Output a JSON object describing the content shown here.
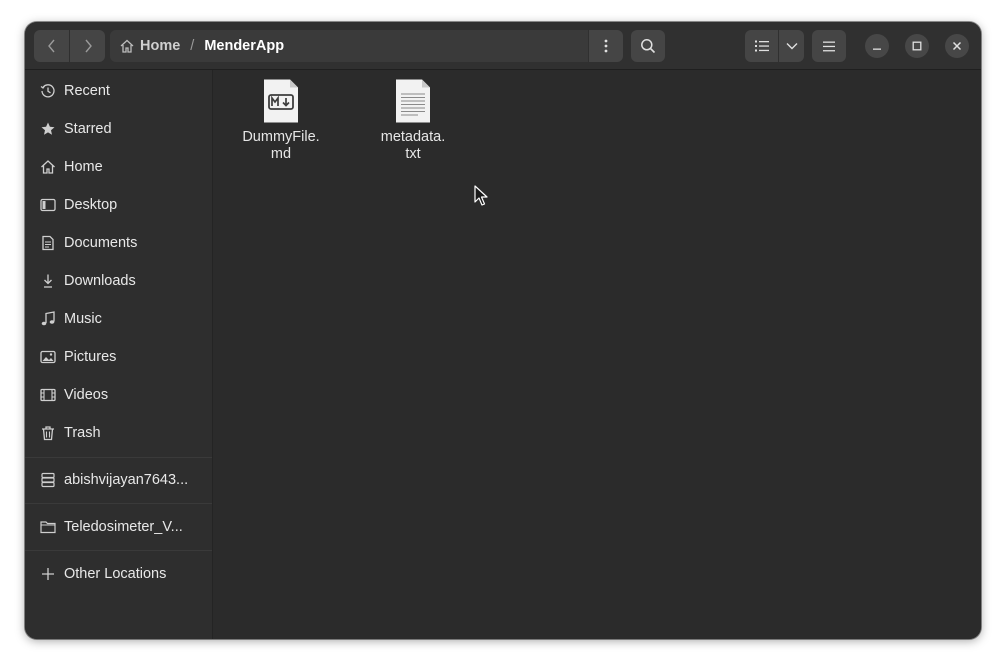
{
  "headerbar": {
    "breadcrumb": {
      "home_label": "Home",
      "separator": "/",
      "current": "MenderApp"
    },
    "icons": {
      "back": "chevron-left-icon",
      "forward": "chevron-right-icon",
      "path_menu": "vertical-dots-icon",
      "search": "search-icon",
      "view_list": "list-view-icon",
      "view_options": "chevron-down-icon",
      "main_menu": "hamburger-menu-icon",
      "minimize": "minimize-icon",
      "maximize": "maximize-icon",
      "close": "close-icon"
    }
  },
  "sidebar": {
    "items": [
      {
        "label": "Recent",
        "icon": "clock-icon"
      },
      {
        "label": "Starred",
        "icon": "star-icon"
      },
      {
        "label": "Home",
        "icon": "home-icon"
      },
      {
        "label": "Desktop",
        "icon": "desktop-icon"
      },
      {
        "label": "Documents",
        "icon": "document-icon"
      },
      {
        "label": "Downloads",
        "icon": "download-icon"
      },
      {
        "label": "Music",
        "icon": "music-icon"
      },
      {
        "label": "Pictures",
        "icon": "picture-icon"
      },
      {
        "label": "Videos",
        "icon": "video-icon"
      },
      {
        "label": "Trash",
        "icon": "trash-icon"
      }
    ],
    "devices": [
      {
        "label": "abishvijayan7643...",
        "icon": "drive-icon"
      }
    ],
    "bookmarks": [
      {
        "label": "Teledosimeter_V...",
        "icon": "folder-icon"
      }
    ],
    "other": {
      "label": "Other Locations",
      "icon": "plus-icon"
    }
  },
  "content": {
    "files": [
      {
        "name_line1": "DummyFile.",
        "name_line2": "md",
        "icon": "markdown-file-icon"
      },
      {
        "name_line1": "metadata.",
        "name_line2": "txt",
        "icon": "text-file-icon"
      }
    ]
  },
  "colors": {
    "window_bg": "#2b2b2b",
    "sidebar_bg": "#2e2e2e",
    "headerbar_bg": "#303030",
    "button_bg": "#454545",
    "text": "#e8e8e8"
  }
}
